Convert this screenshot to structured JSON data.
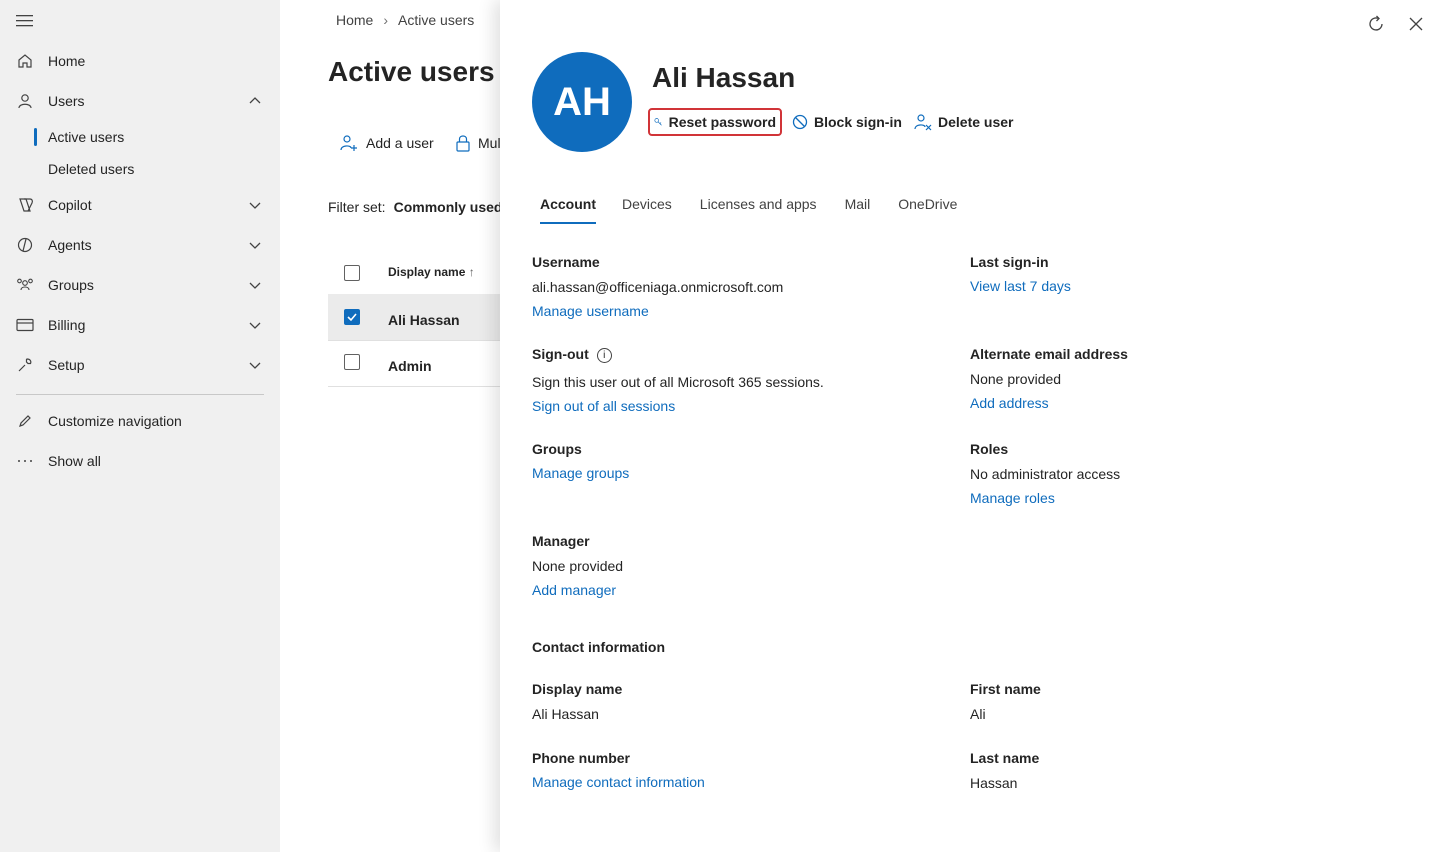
{
  "nav": {
    "items": [
      {
        "label": "Home",
        "icon": "home-icon"
      },
      {
        "label": "Users",
        "icon": "person-icon"
      },
      {
        "label": "Copilot",
        "icon": "copilot-icon"
      },
      {
        "label": "Agents",
        "icon": "agents-icon"
      },
      {
        "label": "Groups",
        "icon": "groups-icon"
      },
      {
        "label": "Billing",
        "icon": "billing-icon"
      },
      {
        "label": "Setup",
        "icon": "wrench-icon"
      }
    ],
    "sub_items": [
      "Active users",
      "Deleted users"
    ],
    "customize": "Customize navigation",
    "show_all": "Show all"
  },
  "background": {
    "breadcrumb": [
      "Home",
      "Active users"
    ],
    "title": "Active users",
    "commands": [
      "Add a user",
      "Mul"
    ],
    "filter_label": "Filter set:",
    "filter_value": "Commonly used",
    "column_display_name": "Display name",
    "rows": [
      "Ali Hassan",
      "Admin"
    ]
  },
  "panel": {
    "initials": "AH",
    "name": "Ali Hassan",
    "actions": {
      "reset": "Reset password",
      "block": "Block sign-in",
      "delete": "Delete user"
    },
    "tabs": [
      "Account",
      "Devices",
      "Licenses and apps",
      "Mail",
      "OneDrive"
    ],
    "username": {
      "label": "Username",
      "value": "ali.hassan@officeniaga.onmicrosoft.com",
      "link": "Manage username"
    },
    "last_signin": {
      "label": "Last sign-in",
      "link": "View last 7 days"
    },
    "signout": {
      "label": "Sign-out",
      "value": "Sign this user out of all Microsoft 365 sessions.",
      "link": "Sign out of all sessions"
    },
    "alt_email": {
      "label": "Alternate email address",
      "value": "None provided",
      "link": "Add address"
    },
    "groups": {
      "label": "Groups",
      "link": "Manage groups"
    },
    "roles": {
      "label": "Roles",
      "value": "No administrator access",
      "link": "Manage roles"
    },
    "manager": {
      "label": "Manager",
      "value": "None provided",
      "link": "Add manager"
    },
    "contact_heading": "Contact information",
    "display_name": {
      "label": "Display name",
      "value": "Ali Hassan"
    },
    "first_name": {
      "label": "First name",
      "value": "Ali"
    },
    "phone": {
      "label": "Phone number",
      "link": "Manage contact information"
    },
    "last_name": {
      "label": "Last name",
      "value": "Hassan"
    }
  },
  "colors": {
    "accent": "#0f6cbd",
    "highlight": "#d13438",
    "nav_bg": "#f0f0f0"
  }
}
